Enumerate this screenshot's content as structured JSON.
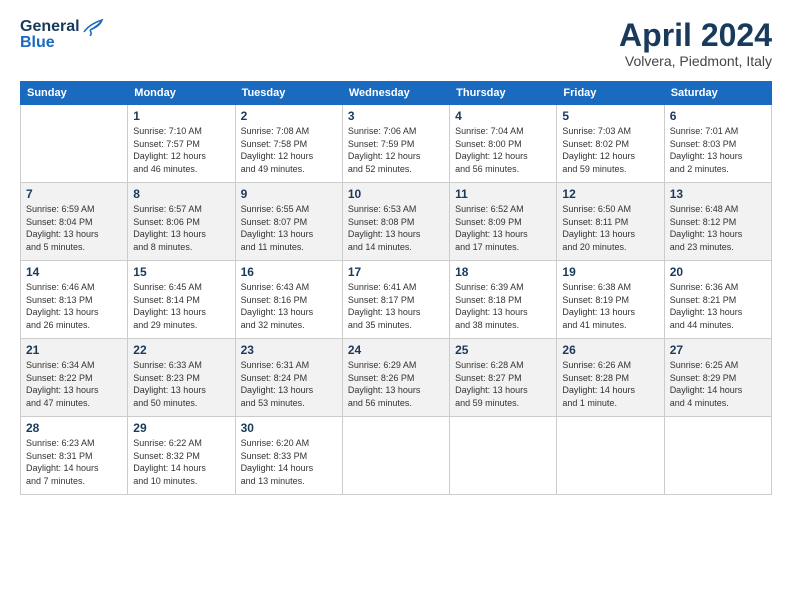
{
  "header": {
    "logo_general": "General",
    "logo_blue": "Blue",
    "month_title": "April 2024",
    "location": "Volvera, Piedmont, Italy"
  },
  "weekdays": [
    "Sunday",
    "Monday",
    "Tuesday",
    "Wednesday",
    "Thursday",
    "Friday",
    "Saturday"
  ],
  "weeks": [
    [
      {
        "day": null,
        "info": null
      },
      {
        "day": "1",
        "info": "Sunrise: 7:10 AM\nSunset: 7:57 PM\nDaylight: 12 hours\nand 46 minutes."
      },
      {
        "day": "2",
        "info": "Sunrise: 7:08 AM\nSunset: 7:58 PM\nDaylight: 12 hours\nand 49 minutes."
      },
      {
        "day": "3",
        "info": "Sunrise: 7:06 AM\nSunset: 7:59 PM\nDaylight: 12 hours\nand 52 minutes."
      },
      {
        "day": "4",
        "info": "Sunrise: 7:04 AM\nSunset: 8:00 PM\nDaylight: 12 hours\nand 56 minutes."
      },
      {
        "day": "5",
        "info": "Sunrise: 7:03 AM\nSunset: 8:02 PM\nDaylight: 12 hours\nand 59 minutes."
      },
      {
        "day": "6",
        "info": "Sunrise: 7:01 AM\nSunset: 8:03 PM\nDaylight: 13 hours\nand 2 minutes."
      }
    ],
    [
      {
        "day": "7",
        "info": "Sunrise: 6:59 AM\nSunset: 8:04 PM\nDaylight: 13 hours\nand 5 minutes."
      },
      {
        "day": "8",
        "info": "Sunrise: 6:57 AM\nSunset: 8:06 PM\nDaylight: 13 hours\nand 8 minutes."
      },
      {
        "day": "9",
        "info": "Sunrise: 6:55 AM\nSunset: 8:07 PM\nDaylight: 13 hours\nand 11 minutes."
      },
      {
        "day": "10",
        "info": "Sunrise: 6:53 AM\nSunset: 8:08 PM\nDaylight: 13 hours\nand 14 minutes."
      },
      {
        "day": "11",
        "info": "Sunrise: 6:52 AM\nSunset: 8:09 PM\nDaylight: 13 hours\nand 17 minutes."
      },
      {
        "day": "12",
        "info": "Sunrise: 6:50 AM\nSunset: 8:11 PM\nDaylight: 13 hours\nand 20 minutes."
      },
      {
        "day": "13",
        "info": "Sunrise: 6:48 AM\nSunset: 8:12 PM\nDaylight: 13 hours\nand 23 minutes."
      }
    ],
    [
      {
        "day": "14",
        "info": "Sunrise: 6:46 AM\nSunset: 8:13 PM\nDaylight: 13 hours\nand 26 minutes."
      },
      {
        "day": "15",
        "info": "Sunrise: 6:45 AM\nSunset: 8:14 PM\nDaylight: 13 hours\nand 29 minutes."
      },
      {
        "day": "16",
        "info": "Sunrise: 6:43 AM\nSunset: 8:16 PM\nDaylight: 13 hours\nand 32 minutes."
      },
      {
        "day": "17",
        "info": "Sunrise: 6:41 AM\nSunset: 8:17 PM\nDaylight: 13 hours\nand 35 minutes."
      },
      {
        "day": "18",
        "info": "Sunrise: 6:39 AM\nSunset: 8:18 PM\nDaylight: 13 hours\nand 38 minutes."
      },
      {
        "day": "19",
        "info": "Sunrise: 6:38 AM\nSunset: 8:19 PM\nDaylight: 13 hours\nand 41 minutes."
      },
      {
        "day": "20",
        "info": "Sunrise: 6:36 AM\nSunset: 8:21 PM\nDaylight: 13 hours\nand 44 minutes."
      }
    ],
    [
      {
        "day": "21",
        "info": "Sunrise: 6:34 AM\nSunset: 8:22 PM\nDaylight: 13 hours\nand 47 minutes."
      },
      {
        "day": "22",
        "info": "Sunrise: 6:33 AM\nSunset: 8:23 PM\nDaylight: 13 hours\nand 50 minutes."
      },
      {
        "day": "23",
        "info": "Sunrise: 6:31 AM\nSunset: 8:24 PM\nDaylight: 13 hours\nand 53 minutes."
      },
      {
        "day": "24",
        "info": "Sunrise: 6:29 AM\nSunset: 8:26 PM\nDaylight: 13 hours\nand 56 minutes."
      },
      {
        "day": "25",
        "info": "Sunrise: 6:28 AM\nSunset: 8:27 PM\nDaylight: 13 hours\nand 59 minutes."
      },
      {
        "day": "26",
        "info": "Sunrise: 6:26 AM\nSunset: 8:28 PM\nDaylight: 14 hours\nand 1 minute."
      },
      {
        "day": "27",
        "info": "Sunrise: 6:25 AM\nSunset: 8:29 PM\nDaylight: 14 hours\nand 4 minutes."
      }
    ],
    [
      {
        "day": "28",
        "info": "Sunrise: 6:23 AM\nSunset: 8:31 PM\nDaylight: 14 hours\nand 7 minutes."
      },
      {
        "day": "29",
        "info": "Sunrise: 6:22 AM\nSunset: 8:32 PM\nDaylight: 14 hours\nand 10 minutes."
      },
      {
        "day": "30",
        "info": "Sunrise: 6:20 AM\nSunset: 8:33 PM\nDaylight: 14 hours\nand 13 minutes."
      },
      {
        "day": null,
        "info": null
      },
      {
        "day": null,
        "info": null
      },
      {
        "day": null,
        "info": null
      },
      {
        "day": null,
        "info": null
      }
    ]
  ]
}
